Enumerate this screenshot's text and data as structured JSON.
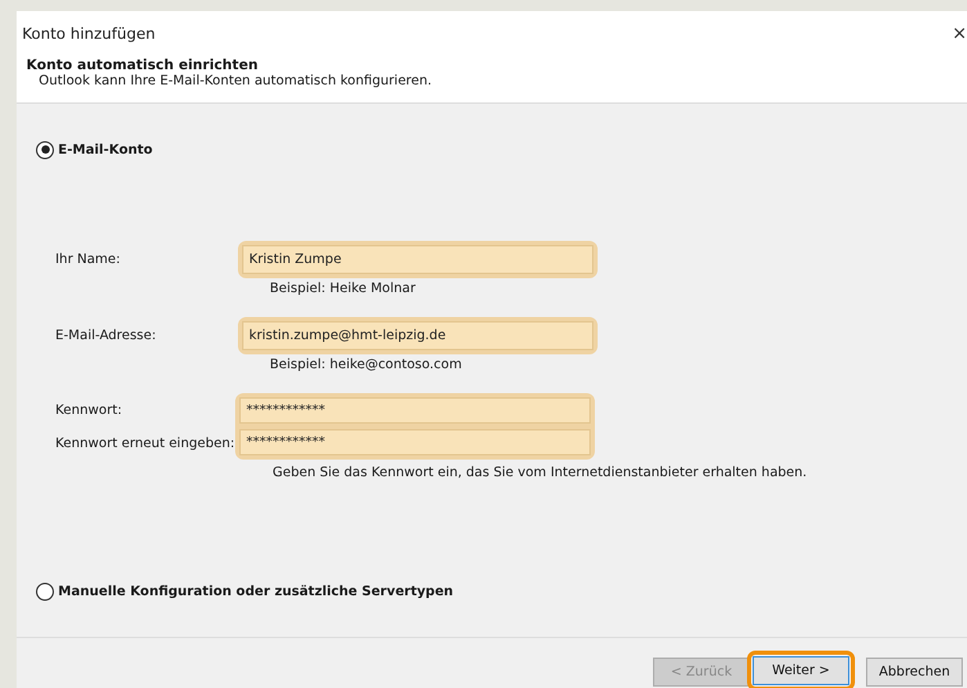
{
  "window": {
    "title": "Konto hinzufügen",
    "close": "×"
  },
  "header": {
    "title": "Konto automatisch einrichten",
    "subtitle": "Outlook kann Ihre E-Mail-Konten automatisch konfigurieren."
  },
  "options": [
    {
      "label": "E-Mail-Konto",
      "selected": true
    },
    {
      "label": "Manuelle Konfiguration oder zusätzliche Servertypen",
      "selected": false
    }
  ],
  "fields": [
    {
      "label": "Ihr Name:",
      "value": "Kristin Zumpe",
      "hint": "Beispiel: Heike Molnar",
      "highlighted": true
    },
    {
      "label": "E-Mail-Adresse:",
      "value": "kristin.zumpe@hmt-leipzig.de",
      "hint": "Beispiel: heike@contoso.com",
      "highlighted": true
    }
  ],
  "password_fields": [
    {
      "label": "Kennwort:",
      "value": "************"
    },
    {
      "label": "Kennwort erneut eingeben:",
      "value": "************"
    }
  ],
  "password_highlighted": true,
  "password_hint": "Geben Sie das Kennwort ein, das Sie vom Internetdienstanbieter erhalten haben.",
  "buttons": [
    {
      "label": "< Zurück",
      "disabled": true,
      "highlighted": false
    },
    {
      "label": "Weiter >",
      "disabled": false,
      "highlighted": true
    },
    {
      "label": "Abbrechen",
      "disabled": false,
      "highlighted": false
    }
  ]
}
